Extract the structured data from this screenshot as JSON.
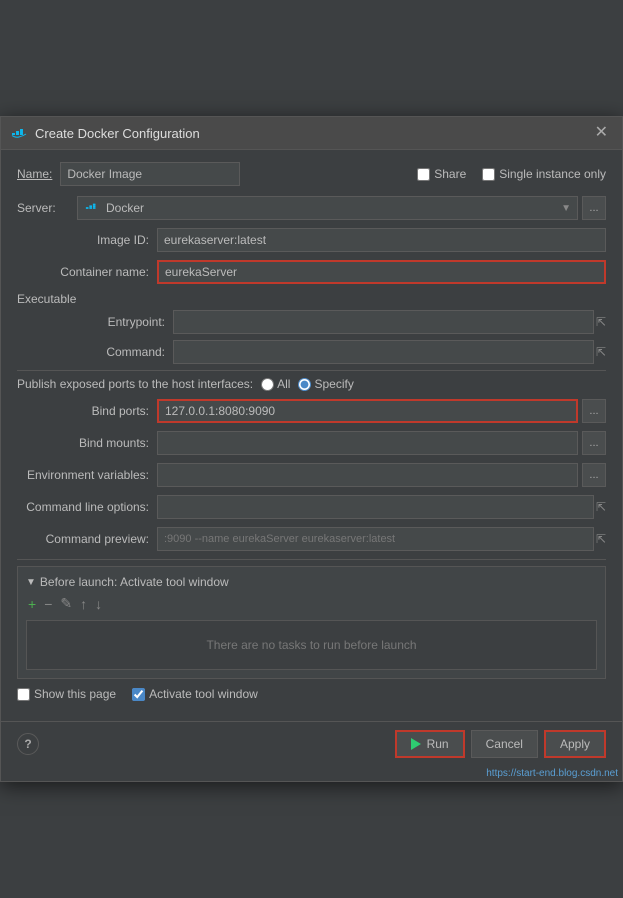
{
  "dialog": {
    "title": "Create Docker Configuration",
    "close_label": "✕"
  },
  "title_bar": {
    "icon": "docker",
    "text": "Create Docker Configuration"
  },
  "name_row": {
    "label": "Name:",
    "value": "Docker Image",
    "share_label": "Share",
    "single_instance_label": "Single instance only"
  },
  "server_row": {
    "label": "Server:",
    "value": "Docker",
    "ellipsis": "..."
  },
  "image_id_row": {
    "label": "Image ID:",
    "value": "eurekaserver:latest"
  },
  "container_name_row": {
    "label": "Container name:",
    "value": "eurekaServer"
  },
  "executable_section": {
    "label": "Executable"
  },
  "entrypoint_row": {
    "label": "Entrypoint:",
    "value": "",
    "expand": "⇱"
  },
  "command_row": {
    "label": "Command:",
    "value": "",
    "expand": "⇱"
  },
  "ports_section": {
    "label": "Publish exposed ports to the host interfaces:",
    "all_label": "All",
    "specify_label": "Specify"
  },
  "bind_ports_row": {
    "label": "Bind ports:",
    "value": "127.0.0.1:8080:9090",
    "ellipsis": "..."
  },
  "bind_mounts_row": {
    "label": "Bind mounts:",
    "value": "",
    "ellipsis": "..."
  },
  "env_vars_row": {
    "label": "Environment variables:",
    "value": "",
    "ellipsis": "..."
  },
  "cmd_line_options_row": {
    "label": "Command line options:",
    "value": "",
    "expand": "⇱"
  },
  "cmd_preview_row": {
    "label": "Command preview:",
    "value": ":9090 --name eurekaServer eurekaserver:latest",
    "expand": "⇱"
  },
  "before_launch": {
    "header": "Before launch: Activate tool window",
    "triangle": "▼",
    "add_btn": "+",
    "remove_btn": "−",
    "edit_btn": "✎",
    "up_btn": "↑",
    "down_btn": "↓",
    "no_tasks_text": "There are no tasks to run before launch"
  },
  "bottom_checkboxes": {
    "show_page_label": "Show this page",
    "activate_tool_label": "Activate tool window"
  },
  "footer": {
    "help": "?",
    "run_label": "Run",
    "cancel_label": "Cancel",
    "apply_label": "Apply"
  },
  "watermark": {
    "url": "https://start-end.blog.csdn.net"
  }
}
